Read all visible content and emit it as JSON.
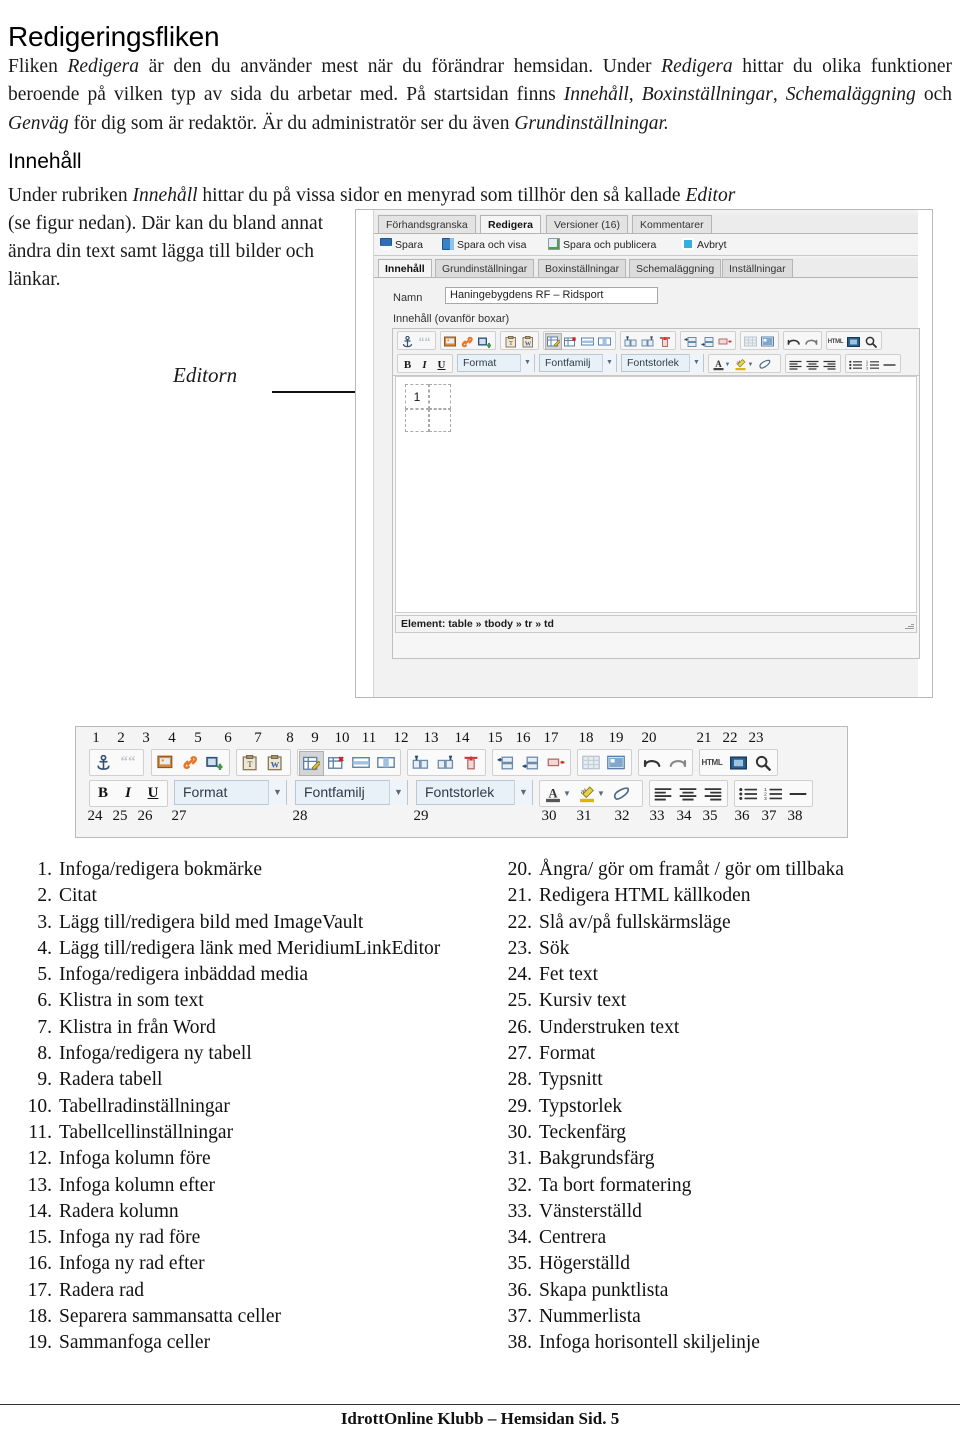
{
  "document": {
    "title": "Redigeringsfliken",
    "intro": "Fliken <em>Redigera</em> är den du använder mest när du förändrar hemsidan. Under <em>Redigera</em> hittar du olika funktioner beroende på vilken typ av sida du arbetar med. På startsidan finns <em>Innehåll</em>, <em>Boxinställningar</em>, <em>Schemaläggning</em> och <em>Genväg</em> för dig som är redaktör. Är du administratör ser du även <em>Grundinställningar.</em>",
    "section_heading": "Innehåll",
    "section_para_a": "Under rubriken <em>Innehåll</em> hittar du på vissa sidor en menyrad som tillhör den så kallade <em>Editor</em>",
    "section_para_b": "(se figur nedan). Där kan du bland annat ändra din text samt lägga till bilder och länkar.",
    "callout_label": "Editorn",
    "footer": "IdrottOnline Klubb – Hemsidan  Sid. 5"
  },
  "editor_screenshot": {
    "tabs": [
      {
        "label": "Förhandsgranska",
        "active": false
      },
      {
        "label": "Redigera",
        "active": true
      },
      {
        "label": "Versioner (16)",
        "active": false
      },
      {
        "label": "Kommentarer",
        "active": false
      }
    ],
    "save_bar": [
      {
        "label": "Spara",
        "icon": "save-icon"
      },
      {
        "label": "Spara och visa",
        "icon": "save-and-view-icon"
      },
      {
        "label": "Spara och publicera",
        "icon": "save-and-publish-icon"
      },
      {
        "label": "Avbryt",
        "icon": "cancel-icon"
      }
    ],
    "sub_tabs": [
      {
        "label": "Innehåll",
        "active": true
      },
      {
        "label": "Grundinställningar",
        "active": false
      },
      {
        "label": "Boxinställningar",
        "active": false
      },
      {
        "label": "Schemaläggning",
        "active": false
      },
      {
        "label": "Inställningar",
        "active": false
      }
    ],
    "name_label": "Namn",
    "name_value": "Haningebygdens RF – Ridsport",
    "content_label": "Innehåll (ovanför boxar)",
    "combos": [
      {
        "label": "Format"
      },
      {
        "label": "Fontfamilj"
      },
      {
        "label": "Fontstorlek"
      }
    ],
    "bold": "B",
    "italic": "I",
    "underline": "U",
    "html_button": "HTML",
    "canvas_cell_text": "1",
    "status_text": "Element: table » tbody » tr » td"
  },
  "legend_figure": {
    "numbers_row1": [
      "1",
      "2",
      "3",
      "4",
      "5",
      "6",
      "7",
      "8",
      "9",
      "10",
      "11",
      "12",
      "13",
      "14",
      "15",
      "16",
      "17",
      "18",
      "19",
      "20",
      "21",
      "22",
      "23"
    ],
    "numbers_row2": [
      "24",
      "25",
      "26",
      "27",
      "28",
      "29",
      "30",
      "31",
      "32",
      "33",
      "34",
      "35",
      "36",
      "37",
      "38"
    ],
    "combos": [
      {
        "label": "Format"
      },
      {
        "label": "Fontfamilj"
      },
      {
        "label": "Fontstorlek"
      }
    ],
    "bold": "B",
    "italic": "I",
    "underline": "U",
    "html_button": "HTML"
  },
  "legend_list_left": [
    {
      "n": "1.",
      "t": "Infoga/redigera bokmärke"
    },
    {
      "n": "2.",
      "t": "Citat"
    },
    {
      "n": "3.",
      "t": "Lägg till/redigera bild med ImageVault"
    },
    {
      "n": "4.",
      "t": "Lägg till/redigera länk med MeridiumLinkEditor"
    },
    {
      "n": "5.",
      "t": "Infoga/redigera inbäddad media"
    },
    {
      "n": "6.",
      "t": "Klistra in som text"
    },
    {
      "n": "7.",
      "t": "Klistra in från Word"
    },
    {
      "n": "8.",
      "t": "Infoga/redigera ny tabell"
    },
    {
      "n": "9.",
      "t": "Radera tabell"
    },
    {
      "n": "10.",
      "t": "Tabellradinställningar"
    },
    {
      "n": "11.",
      "t": "Tabellcellinställningar"
    },
    {
      "n": "12.",
      "t": "Infoga kolumn före"
    },
    {
      "n": "13.",
      "t": "Infoga kolumn efter"
    },
    {
      "n": "14.",
      "t": "Radera kolumn"
    },
    {
      "n": "15.",
      "t": "Infoga ny rad före"
    },
    {
      "n": "16.",
      "t": "Infoga ny rad efter"
    },
    {
      "n": "17.",
      "t": "Radera rad"
    },
    {
      "n": "18.",
      "t": "Separera sammansatta celler"
    },
    {
      "n": "19.",
      "t": "Sammanfoga celler"
    }
  ],
  "legend_list_right": [
    {
      "n": "20.",
      "t": "Ångra/ gör om framåt / gör om tillbaka"
    },
    {
      "n": "21.",
      "t": "Redigera HTML källkoden"
    },
    {
      "n": "22.",
      "t": "Slå av/på fullskärmsläge"
    },
    {
      "n": "23.",
      "t": "Sök"
    },
    {
      "n": "24.",
      "t": "Fet text"
    },
    {
      "n": "25.",
      "t": "Kursiv text"
    },
    {
      "n": "26.",
      "t": "Understruken text"
    },
    {
      "n": "27.",
      "t": "Format"
    },
    {
      "n": "28.",
      "t": "Typsnitt"
    },
    {
      "n": "29.",
      "t": "Typstorlek"
    },
    {
      "n": "30.",
      "t": "Teckenfärg"
    },
    {
      "n": "31.",
      "t": "Bakgrundsfärg"
    },
    {
      "n": "32.",
      "t": "Ta bort formatering"
    },
    {
      "n": "33.",
      "t": "Vänsterställd"
    },
    {
      "n": "34.",
      "t": "Centrera"
    },
    {
      "n": "35.",
      "t": "Högerställd"
    },
    {
      "n": "36.",
      "t": "Skapa punktlista"
    },
    {
      "n": "37.",
      "t": "Nummerlista"
    },
    {
      "n": "38.",
      "t": "Infoga horisontell skiljelinje"
    }
  ]
}
